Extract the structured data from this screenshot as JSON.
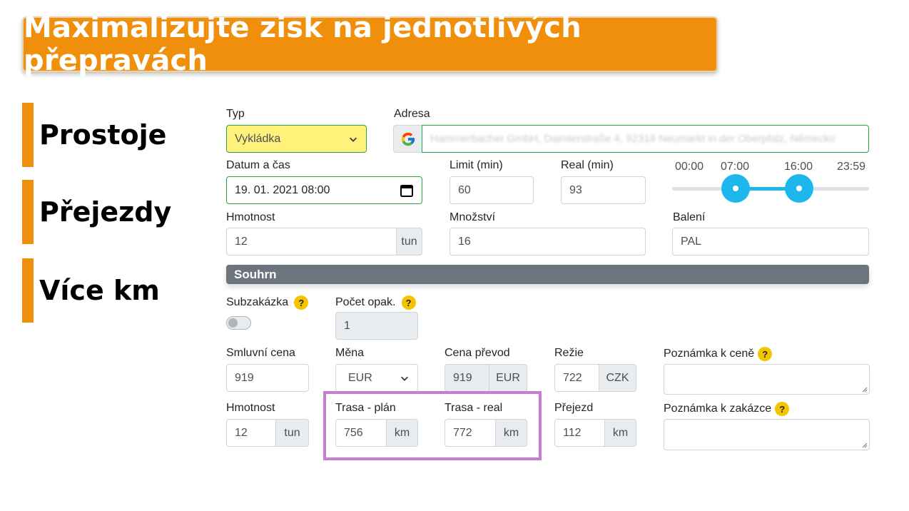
{
  "banner": {
    "title": "Maximalizujte zisk na jednotlivých přepravách"
  },
  "side": {
    "items": [
      "Prostoje",
      "Přejezdy",
      "Více km"
    ]
  },
  "stop": {
    "typ_label": "Typ",
    "typ_value": "Vykládka",
    "adresa_label": "Adresa",
    "adresa_value": "Hammerbacher GmbH, Daimlerstraße 4, 92318 Neumarkt in der Oberpfalz, Německo",
    "datum_label": "Datum a čas",
    "datum_value": "19. 01. 2021 08:00",
    "limit_label": "Limit (min)",
    "limit_value": "60",
    "real_label": "Real (min)",
    "real_value": "93",
    "hmotnost_label": "Hmotnost",
    "hmotnost_value": "12",
    "hmotnost_unit": "tun",
    "mnozstvi_label": "Množství",
    "mnozstvi_value": "16",
    "baleni_label": "Balení",
    "baleni_value": "PAL"
  },
  "time_slider": {
    "ticks": [
      "00:00",
      "07:00",
      "16:00",
      "23:59"
    ],
    "from": "07:00",
    "to": "16:00",
    "accent_color": "#1fb6ee"
  },
  "summary": {
    "header": "Souhrn",
    "subzakazka_label": "Subzakázka",
    "subzakazka_on": false,
    "pocet_label": "Počet opak.",
    "pocet_value": "1",
    "smluvni_label": "Smluvní cena",
    "smluvni_value": "919",
    "mena_label": "Měna",
    "mena_value": "EUR",
    "prevod_label": "Cena převod",
    "prevod_value": "919",
    "prevod_unit": "EUR",
    "rezie_label": "Režie",
    "rezie_value": "722",
    "rezie_unit": "CZK",
    "poznamka_cena_label": "Poznámka k ceně",
    "hmotnost_label": "Hmotnost",
    "hmotnost_value": "12",
    "hmotnost_unit": "tun",
    "trasa_plan_label": "Trasa - plán",
    "trasa_plan_value": "756",
    "trasa_plan_unit": "km",
    "trasa_real_label": "Trasa - real",
    "trasa_real_value": "772",
    "trasa_real_unit": "km",
    "prejezd_label": "Přejezd",
    "prejezd_value": "112",
    "prejezd_unit": "km",
    "poznamka_zakazka_label": "Poznámka k zakázce",
    "help_glyph": "?"
  },
  "colors": {
    "brand_orange": "#ef8f0c",
    "highlight_purple": "#c77dd3",
    "select_yellow": "#fff17a",
    "valid_green": "#28a745"
  }
}
